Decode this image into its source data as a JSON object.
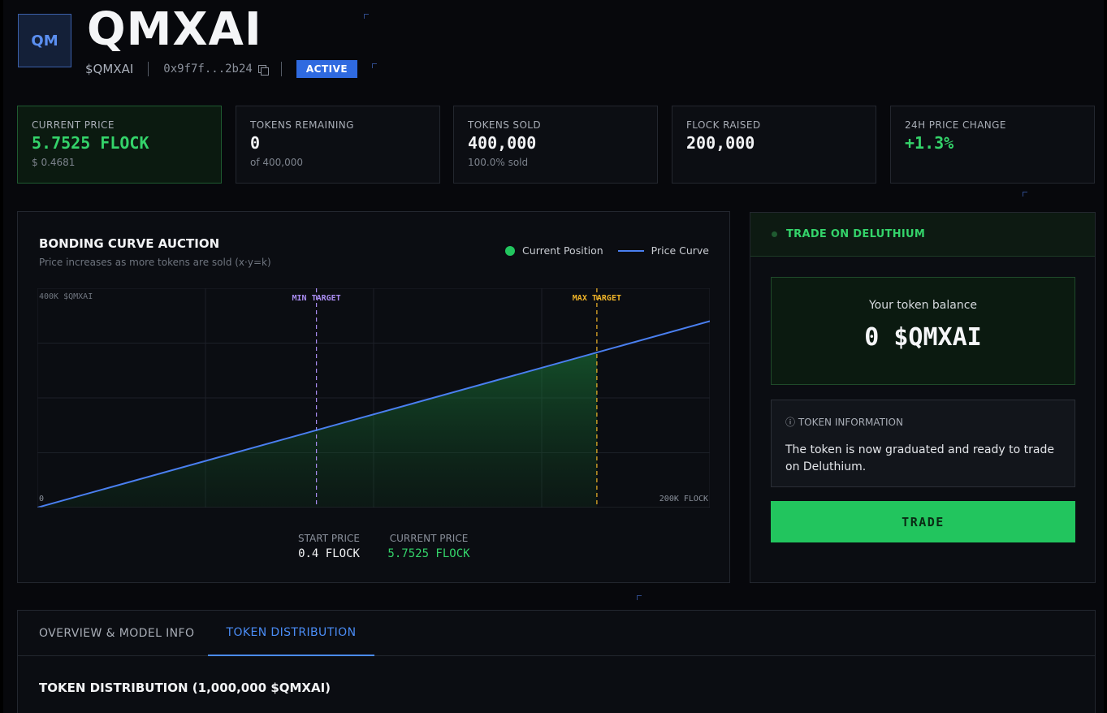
{
  "header": {
    "logo_text": "QM",
    "title": "QMXAI",
    "ticker": "$QMXAI",
    "address": "0x9f7f...2b24",
    "status": "ACTIVE"
  },
  "stats": [
    {
      "label": "CURRENT PRICE",
      "value": "5.7525 FLOCK",
      "sub": "$ 0.4681"
    },
    {
      "label": "TOKENS REMAINING",
      "value": "0",
      "sub": "of 400,000"
    },
    {
      "label": "TOKENS SOLD",
      "value": "400,000",
      "sub": "100.0% sold"
    },
    {
      "label": "FLOCK RAISED",
      "value": "200,000",
      "sub": ""
    },
    {
      "label": "24H PRICE CHANGE",
      "value": "+1.3%",
      "sub": ""
    }
  ],
  "auction": {
    "title": "BONDING CURVE AUCTION",
    "subtitle": "Price increases as more tokens are sold (x·y=k)",
    "legend_current": "Current Position",
    "legend_curve": "Price Curve",
    "start_label": "START PRICE",
    "start_value": "0.4 FLOCK",
    "current_label": "CURRENT PRICE",
    "current_value": "5.7525 FLOCK"
  },
  "chart_data": {
    "type": "line",
    "y_top_label": "400K $QMXAI",
    "origin_label": "0",
    "x_end_label": "200K FLOCK",
    "min_target_label": "MIN TARGET",
    "max_target_label": "MAX TARGET",
    "xlim": [
      0,
      1
    ],
    "ylim": [
      0,
      1
    ],
    "curve": {
      "x": [
        0,
        1
      ],
      "y": [
        0,
        0.85
      ]
    },
    "min_target_x": 0.415,
    "max_target_x": 0.832,
    "grid": true,
    "colors": {
      "curve": "#4a7ff0",
      "fill": "#1a8a3e",
      "min_target": "#a98cf0",
      "max_target": "#f0b429"
    }
  },
  "trade": {
    "header": "TRADE ON DELUTHIUM",
    "balance_label": "Your token balance",
    "balance_value": "0 $QMXAI",
    "info_label": "ⓘ TOKEN INFORMATION",
    "info_text": "The token is now graduated and ready to trade on Deluthium.",
    "button": "TRADE"
  },
  "tabs": {
    "overview": "OVERVIEW & MODEL INFO",
    "distribution": "TOKEN DISTRIBUTION",
    "section_title": "TOKEN DISTRIBUTION (1,000,000 $QMXAI)"
  }
}
